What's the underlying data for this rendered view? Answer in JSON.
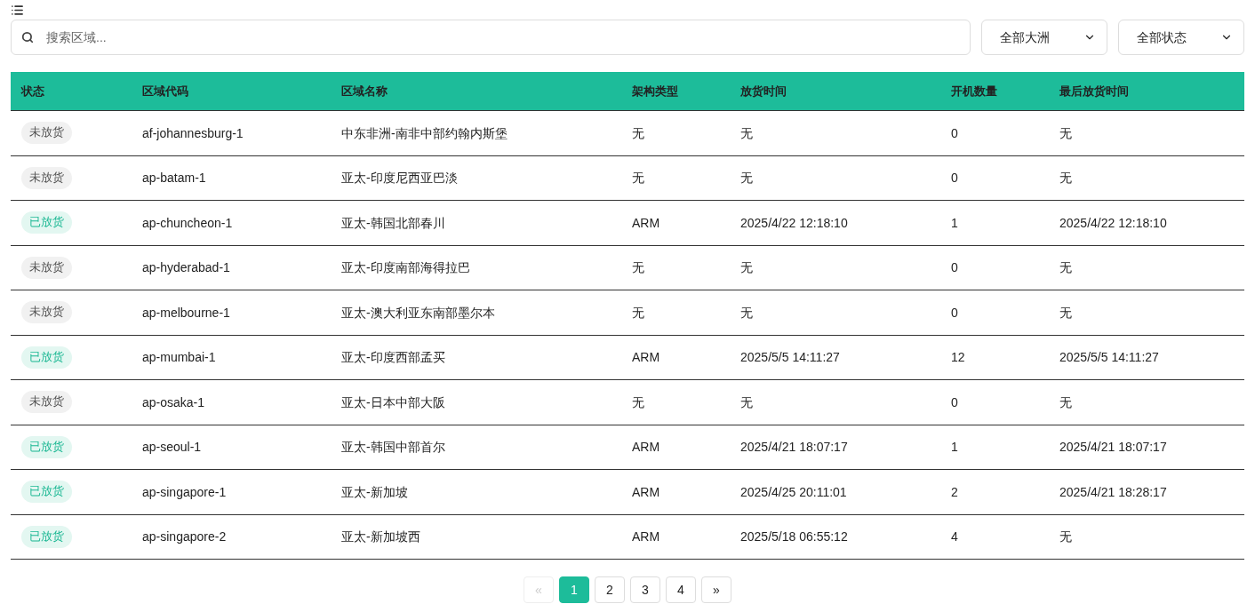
{
  "search": {
    "placeholder": "搜索区域..."
  },
  "filters": [
    {
      "value": "全部大洲"
    },
    {
      "value": "全部状态"
    }
  ],
  "table": {
    "columns": [
      "状态",
      "区域代码",
      "区域名称",
      "架构类型",
      "放货时间",
      "开机数量",
      "最后放货时间"
    ],
    "rows": [
      {
        "cells": [
          {
            "text": "未放货",
            "kind": "pending"
          },
          {
            "text": "af-johannesburg-1",
            "kind": "text"
          },
          {
            "text": "中东非洲-南非中部约翰内斯堡",
            "kind": "text"
          },
          {
            "text": "无",
            "kind": "text"
          },
          {
            "text": "无",
            "kind": "text"
          },
          {
            "text": "0",
            "kind": "text"
          },
          {
            "text": "无",
            "kind": "text"
          }
        ]
      },
      {
        "cells": [
          {
            "text": "未放货",
            "kind": "pending"
          },
          {
            "text": "ap-batam-1",
            "kind": "text"
          },
          {
            "text": "亚太-印度尼西亚巴淡",
            "kind": "text"
          },
          {
            "text": "无",
            "kind": "text"
          },
          {
            "text": "无",
            "kind": "text"
          },
          {
            "text": "0",
            "kind": "text"
          },
          {
            "text": "无",
            "kind": "text"
          }
        ]
      },
      {
        "cells": [
          {
            "text": "已放货",
            "kind": "released"
          },
          {
            "text": "ap-chuncheon-1",
            "kind": "text"
          },
          {
            "text": "亚太-韩国北部春川",
            "kind": "text"
          },
          {
            "text": "ARM",
            "kind": "text"
          },
          {
            "text": "2025/4/22 12:18:10",
            "kind": "text"
          },
          {
            "text": "1",
            "kind": "text"
          },
          {
            "text": "2025/4/22 12:18:10",
            "kind": "text"
          }
        ]
      },
      {
        "cells": [
          {
            "text": "未放货",
            "kind": "pending"
          },
          {
            "text": "ap-hyderabad-1",
            "kind": "text"
          },
          {
            "text": "亚太-印度南部海得拉巴",
            "kind": "text"
          },
          {
            "text": "无",
            "kind": "text"
          },
          {
            "text": "无",
            "kind": "text"
          },
          {
            "text": "0",
            "kind": "text"
          },
          {
            "text": "无",
            "kind": "text"
          }
        ]
      },
      {
        "cells": [
          {
            "text": "未放货",
            "kind": "pending"
          },
          {
            "text": "ap-melbourne-1",
            "kind": "text"
          },
          {
            "text": "亚太-澳大利亚东南部墨尔本",
            "kind": "text"
          },
          {
            "text": "无",
            "kind": "text"
          },
          {
            "text": "无",
            "kind": "text"
          },
          {
            "text": "0",
            "kind": "text"
          },
          {
            "text": "无",
            "kind": "text"
          }
        ]
      },
      {
        "cells": [
          {
            "text": "已放货",
            "kind": "released"
          },
          {
            "text": "ap-mumbai-1",
            "kind": "text"
          },
          {
            "text": "亚太-印度西部孟买",
            "kind": "text"
          },
          {
            "text": "ARM",
            "kind": "text"
          },
          {
            "text": "2025/5/5 14:11:27",
            "kind": "text"
          },
          {
            "text": "12",
            "kind": "text"
          },
          {
            "text": "2025/5/5 14:11:27",
            "kind": "text"
          }
        ]
      },
      {
        "cells": [
          {
            "text": "未放货",
            "kind": "pending"
          },
          {
            "text": "ap-osaka-1",
            "kind": "text"
          },
          {
            "text": "亚太-日本中部大阪",
            "kind": "text"
          },
          {
            "text": "无",
            "kind": "text"
          },
          {
            "text": "无",
            "kind": "text"
          },
          {
            "text": "0",
            "kind": "text"
          },
          {
            "text": "无",
            "kind": "text"
          }
        ]
      },
      {
        "cells": [
          {
            "text": "已放货",
            "kind": "released"
          },
          {
            "text": "ap-seoul-1",
            "kind": "text"
          },
          {
            "text": "亚太-韩国中部首尔",
            "kind": "text"
          },
          {
            "text": "ARM",
            "kind": "text"
          },
          {
            "text": "2025/4/21 18:07:17",
            "kind": "text"
          },
          {
            "text": "1",
            "kind": "text"
          },
          {
            "text": "2025/4/21 18:07:17",
            "kind": "text"
          }
        ]
      },
      {
        "cells": [
          {
            "text": "已放货",
            "kind": "released"
          },
          {
            "text": "ap-singapore-1",
            "kind": "text"
          },
          {
            "text": "亚太-新加坡",
            "kind": "text"
          },
          {
            "text": "ARM",
            "kind": "text"
          },
          {
            "text": "2025/4/25 20:11:01",
            "kind": "text"
          },
          {
            "text": "2",
            "kind": "text"
          },
          {
            "text": "2025/4/21 18:28:17",
            "kind": "text"
          }
        ]
      },
      {
        "cells": [
          {
            "text": "已放货",
            "kind": "released"
          },
          {
            "text": "ap-singapore-2",
            "kind": "text"
          },
          {
            "text": "亚太-新加坡西",
            "kind": "text"
          },
          {
            "text": "ARM",
            "kind": "text"
          },
          {
            "text": "2025/5/18 06:55:12",
            "kind": "text"
          },
          {
            "text": "4",
            "kind": "text"
          },
          {
            "text": "无",
            "kind": "text"
          }
        ]
      }
    ]
  },
  "pagination": {
    "prev": {
      "label": "«",
      "disabled": true
    },
    "pages": [
      {
        "label": "1",
        "selected": true
      },
      {
        "label": "2",
        "selected": false
      },
      {
        "label": "3",
        "selected": false
      },
      {
        "label": "4",
        "selected": false
      }
    ],
    "next": {
      "label": "»",
      "disabled": false
    }
  }
}
